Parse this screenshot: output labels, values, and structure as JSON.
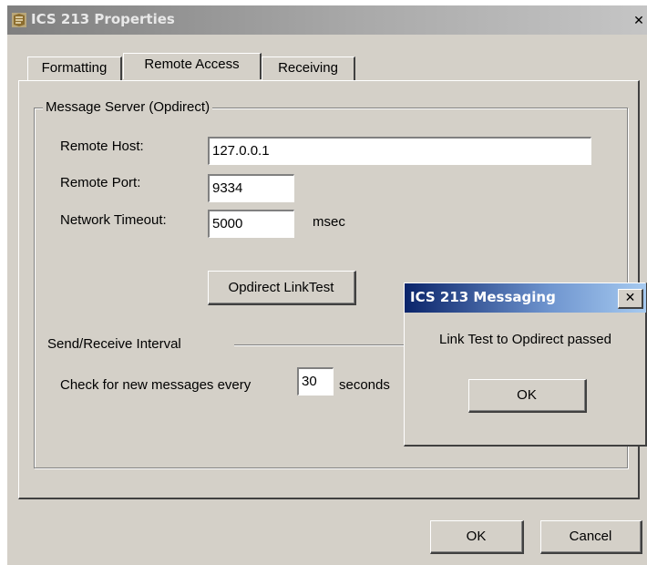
{
  "window": {
    "title": "ICS 213 Properties",
    "close_glyph": "✕"
  },
  "tabs": [
    {
      "label": "Formatting",
      "active": false
    },
    {
      "label": "Remote Access",
      "active": true
    },
    {
      "label": "Receiving",
      "active": false
    }
  ],
  "message_server": {
    "group_label": "Message Server (Opdirect)",
    "remote_host_label": "Remote Host:",
    "remote_host_value": "127.0.0.1",
    "remote_port_label": "Remote Port:",
    "remote_port_value": "9334",
    "timeout_label": "Network Timeout:",
    "timeout_value": "5000",
    "timeout_unit": "msec",
    "link_test_button": "Opdirect LinkTest"
  },
  "interval": {
    "group_label": "Send/Receive Interval",
    "check_prefix": "Check for new messages every",
    "check_value": "30",
    "check_suffix": "seconds"
  },
  "buttons": {
    "ok": "OK",
    "cancel": "Cancel"
  },
  "messaging_dialog": {
    "title": "ICS 213 Messaging",
    "close_glyph": "✕",
    "message": "Link Test to Opdirect passed",
    "ok": "OK"
  }
}
